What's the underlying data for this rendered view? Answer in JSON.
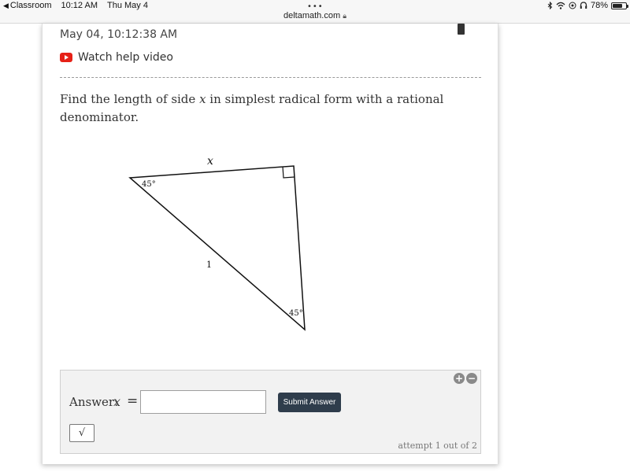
{
  "status_bar": {
    "back_app": "Classroom",
    "time": "10:12 AM",
    "date": "Thu May 4",
    "battery_percent": "78%",
    "battery_level": 0.78
  },
  "browser": {
    "more_dots": "•••",
    "url": "deltamath.com"
  },
  "header": {
    "timestamp": "May 04, 10:12:38 AM",
    "help_video_label": "Watch help video"
  },
  "problem": {
    "text_before": "Find the length of side ",
    "variable": "x",
    "text_after": " in simplest radical form with a rational denominator."
  },
  "figure": {
    "side_label": "x",
    "hypotenuse_label": "1",
    "angle_top": "45°",
    "angle_bottom": "45°"
  },
  "answer": {
    "label": "Answer:",
    "variable": "x",
    "equals": "=",
    "input_value": "",
    "submit_label": "Submit Answer",
    "sqrt_label": "√",
    "zoom_in": "+",
    "zoom_out": "−",
    "attempt_text": "attempt 1 out of 2"
  }
}
